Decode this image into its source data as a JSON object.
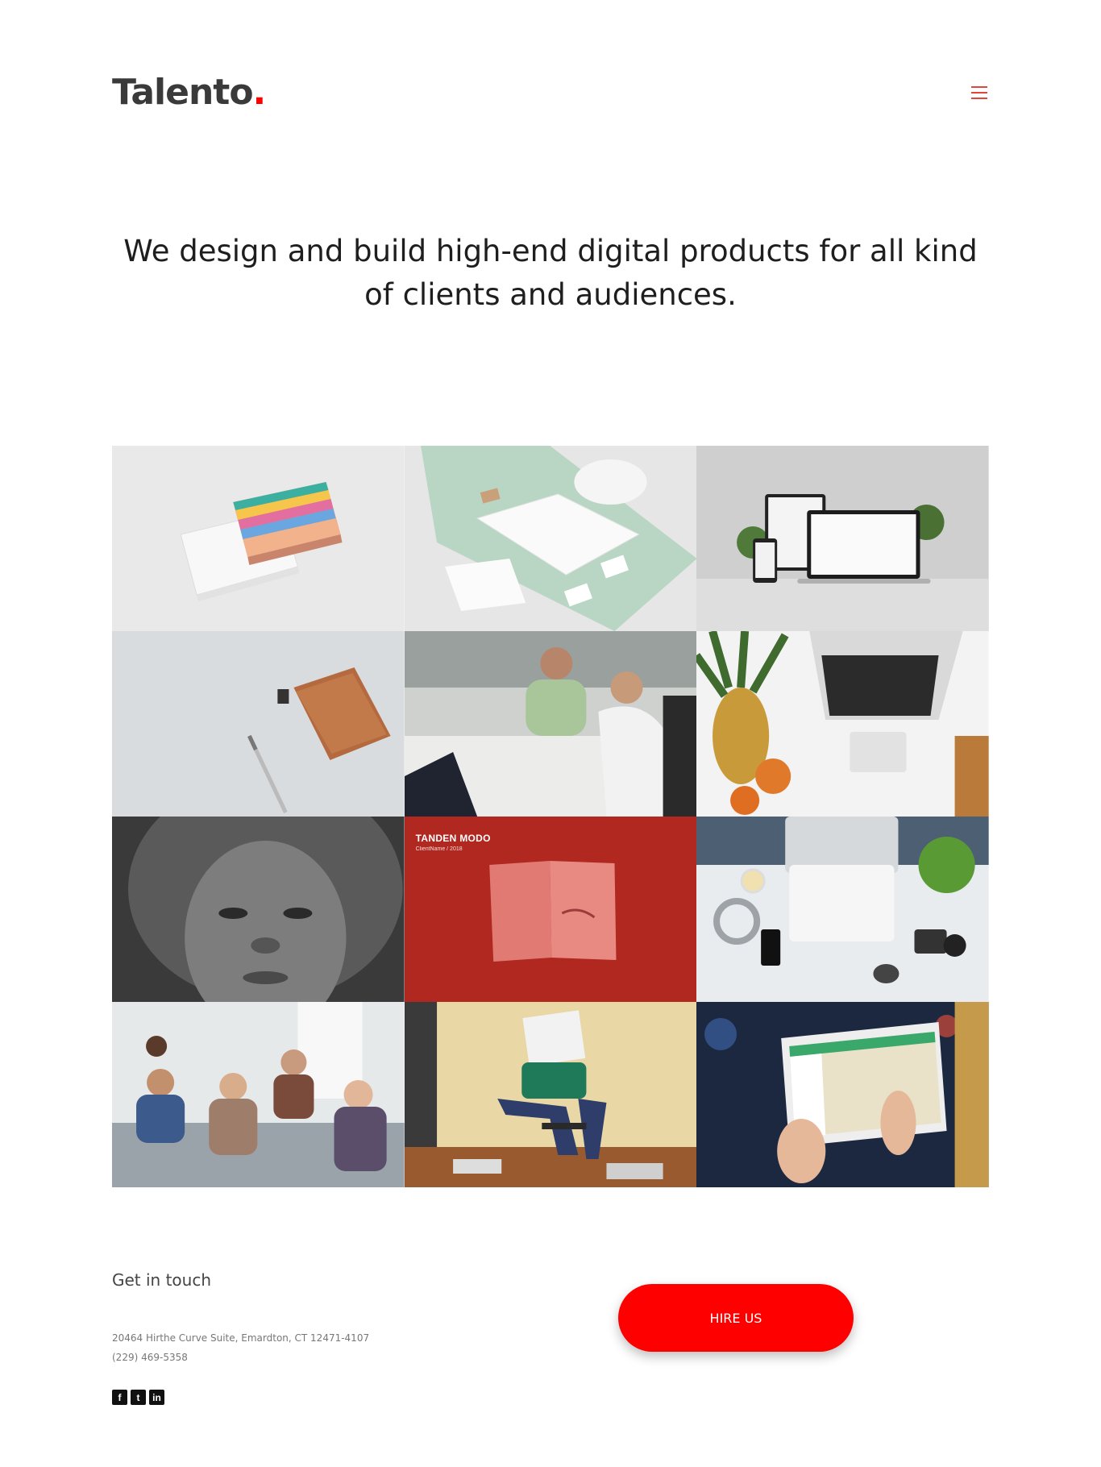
{
  "brand": {
    "name": "Talento",
    "dot": ".",
    "accent_color": "#ff0000"
  },
  "nav": {
    "menu_icon": "hamburger-menu-icon"
  },
  "hero": {
    "headline": "We design and build high-end digital products for all kind of clients and audiences."
  },
  "gallery": {
    "tiles": [
      {
        "name": "business-cards"
      },
      {
        "name": "tshirt-branding"
      },
      {
        "name": "responsive-devices"
      },
      {
        "name": "notebook-pen"
      },
      {
        "name": "team-meeting-laughing"
      },
      {
        "name": "pineapple-laptop"
      },
      {
        "name": "portrait-woman"
      },
      {
        "name": "tanden-modo",
        "title": "TANDEN MODO",
        "subtitle": "ClientName / 2018"
      },
      {
        "name": "desk-workspace"
      },
      {
        "name": "office-team"
      },
      {
        "name": "person-reading"
      },
      {
        "name": "tablet-map"
      }
    ]
  },
  "contact": {
    "heading": "Get in touch",
    "address": "20464 Hirthe Curve Suite, Emardton, CT 12471-4107",
    "phone": "(229) 469-5358",
    "social": [
      {
        "icon": "facebook-icon",
        "glyph": "f"
      },
      {
        "icon": "twitter-icon",
        "glyph": "t"
      },
      {
        "icon": "linkedin-icon",
        "glyph": "in"
      }
    ]
  },
  "cta": {
    "label": "HIRE US",
    "color": "#ff0000"
  }
}
